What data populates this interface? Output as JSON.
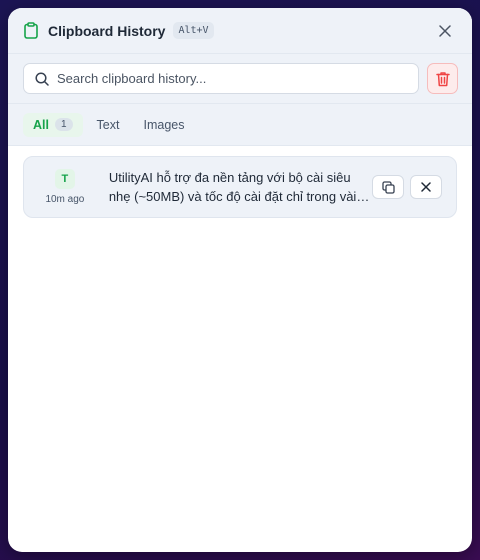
{
  "header": {
    "title": "Clipboard History",
    "shortcut": "Alt+V",
    "close_icon": "close-icon",
    "app_icon": "clipboard-icon"
  },
  "search": {
    "placeholder": "Search clipboard history...",
    "value": "",
    "icon": "search-icon"
  },
  "clear_button": {
    "icon": "trash-icon"
  },
  "tabs": [
    {
      "label": "All",
      "count": "1",
      "active": true
    },
    {
      "label": "Text",
      "active": false
    },
    {
      "label": "Images",
      "active": false
    }
  ],
  "items": [
    {
      "type_badge": "T",
      "time": "10m ago",
      "text": "UtilityAI hỗ trợ đa nền tảng với bộ cài siêu nhẹ (~50MB) và tốc độ cài đặt chỉ trong vài giây."
    }
  ],
  "colors": {
    "accent": "#16a34a",
    "danger": "#ef4444",
    "background": "#1a0f4a"
  }
}
